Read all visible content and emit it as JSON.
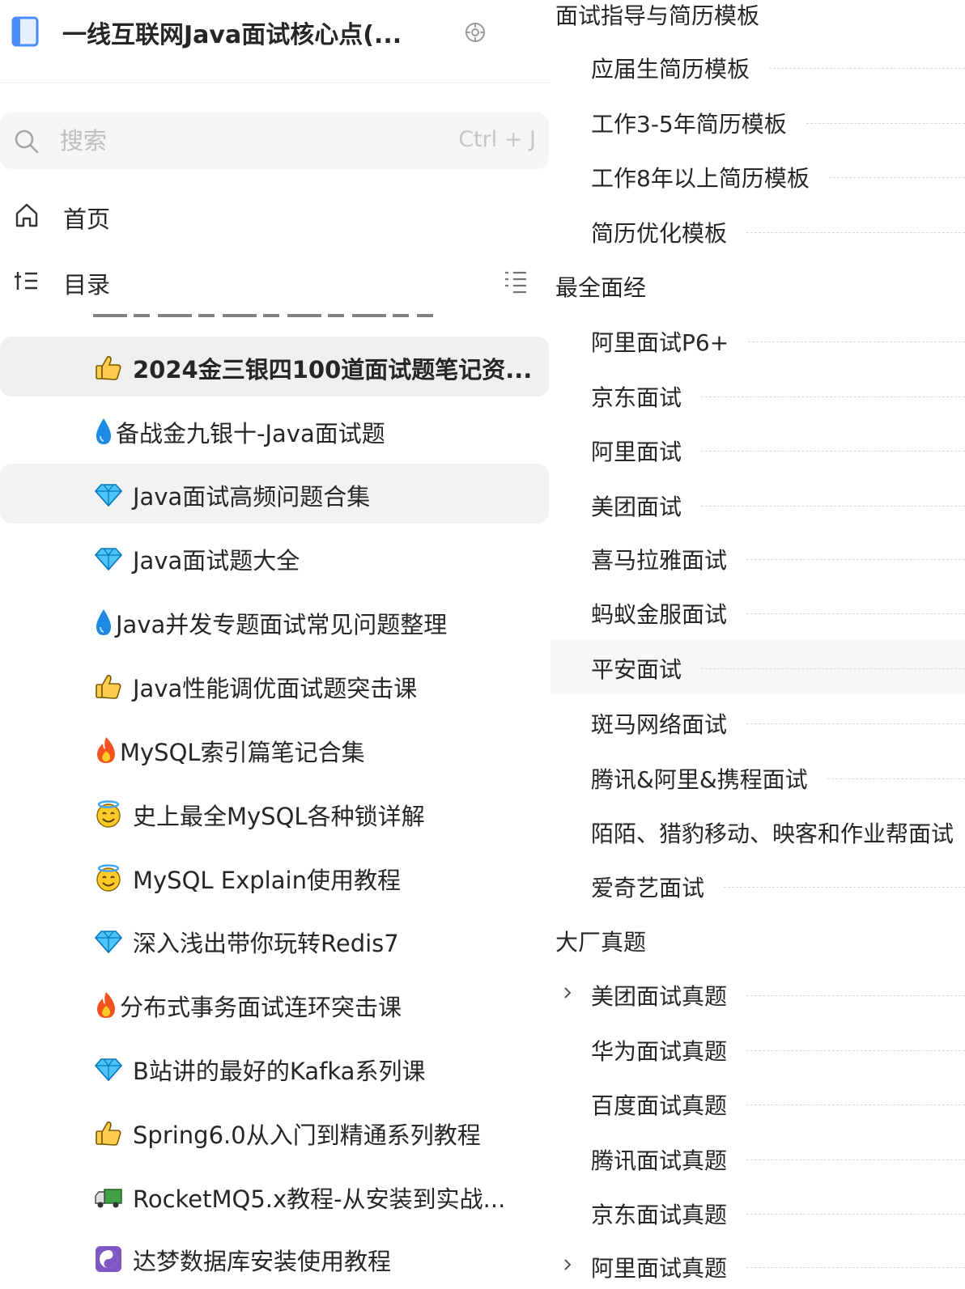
{
  "book": {
    "title": "一线互联网Java面试核心点(...",
    "accent_color": "#4a8cff",
    "icon": "book-icon",
    "settings_icon": "settings-icon"
  },
  "search": {
    "placeholder": "搜索",
    "shortcut": "Ctrl + J",
    "icon": "search-icon"
  },
  "nav": {
    "home_label": "首页",
    "toc_label": "目录"
  },
  "documents": [
    {
      "emoji": "thumbs-up-icon",
      "label": "2024金三银四100道面试题笔记资...",
      "active": true
    },
    {
      "emoji": "droplet-icon",
      "label": "备战金九银十-Java面试题"
    },
    {
      "emoji": "diamond-icon",
      "label": "Java面试高频问题合集",
      "hover": true
    },
    {
      "emoji": "diamond-icon",
      "label": "Java面试题大全"
    },
    {
      "emoji": "droplet-icon",
      "label": "Java并发专题面试常见问题整理"
    },
    {
      "emoji": "thumbs-up-icon",
      "label": "Java性能调优面试题突击课"
    },
    {
      "emoji": "fire-icon",
      "label": "MySQL索引篇笔记合集"
    },
    {
      "emoji": "halo-smile-icon",
      "label": "史上最全MySQL各种锁详解"
    },
    {
      "emoji": "halo-smile-icon",
      "label": "MySQL Explain使用教程"
    },
    {
      "emoji": "diamond-icon",
      "label": "深入浅出带你玩转Redis7"
    },
    {
      "emoji": "fire-icon",
      "label": "分布式事务面试连环突击课"
    },
    {
      "emoji": "diamond-icon",
      "label": "B站讲的最好的Kafka系列课"
    },
    {
      "emoji": "thumbs-up-icon",
      "label": "Spring6.0从入门到精通系列教程"
    },
    {
      "emoji": "truck-icon",
      "label": "RocketMQ5.x教程-从安装到实战..."
    },
    {
      "emoji": "yin-yang-icon",
      "label": "达梦数据库安装使用教程"
    }
  ],
  "toc": [
    {
      "type": "section",
      "label": "面试指导与简历模板"
    },
    {
      "type": "sub",
      "label": "应届生简历模板"
    },
    {
      "type": "sub",
      "label": "工作3-5年简历模板"
    },
    {
      "type": "sub",
      "label": "工作8年以上简历模板"
    },
    {
      "type": "sub",
      "label": "简历优化模板"
    },
    {
      "type": "section",
      "label": "最全面经"
    },
    {
      "type": "sub",
      "label": "阿里面试P6+"
    },
    {
      "type": "sub",
      "label": "京东面试"
    },
    {
      "type": "sub",
      "label": "阿里面试"
    },
    {
      "type": "sub",
      "label": "美团面试"
    },
    {
      "type": "sub",
      "label": "喜马拉雅面试"
    },
    {
      "type": "sub",
      "label": "蚂蚁金服面试"
    },
    {
      "type": "sub",
      "label": "平安面试",
      "hover": true
    },
    {
      "type": "sub",
      "label": "斑马网络面试"
    },
    {
      "type": "sub",
      "label": "腾讯&阿里&携程面试"
    },
    {
      "type": "sub",
      "label": "陌陌、猎豹移动、映客和作业帮面试"
    },
    {
      "type": "sub",
      "label": "爱奇艺面试"
    },
    {
      "type": "section",
      "label": "大厂真题"
    },
    {
      "type": "sub",
      "label": "美团面试真题",
      "collapsible": true
    },
    {
      "type": "sub",
      "label": "华为面试真题"
    },
    {
      "type": "sub",
      "label": "百度面试真题"
    },
    {
      "type": "sub",
      "label": "腾讯面试真题"
    },
    {
      "type": "sub",
      "label": "京东面试真题"
    },
    {
      "type": "sub",
      "label": "阿里面试真题",
      "collapsible": true
    }
  ]
}
